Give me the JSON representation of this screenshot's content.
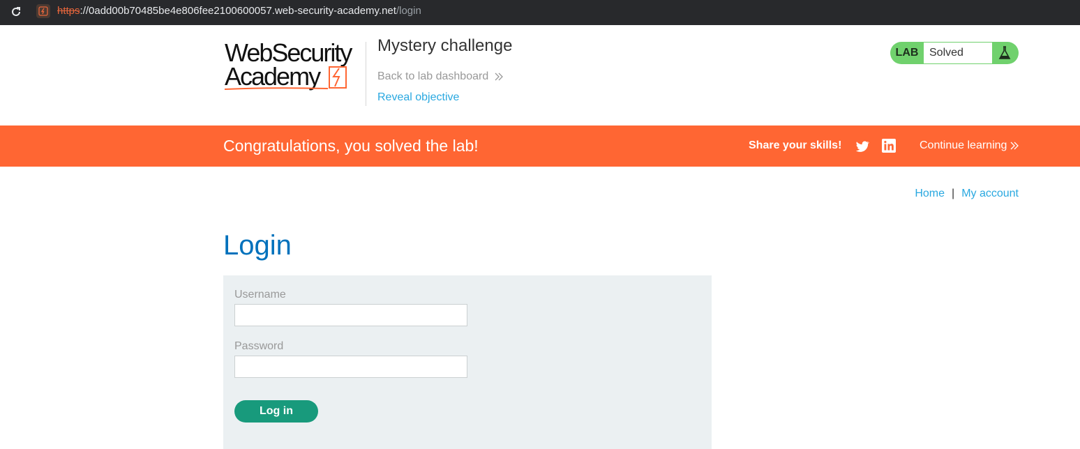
{
  "browser": {
    "url_scheme": "https",
    "url_host": "://0add00b70485be4e806fee2100600057.web-security-academy.net",
    "url_path": "/login",
    "icons": {
      "reload": "reload-icon",
      "site": "site-lightning-icon"
    }
  },
  "header": {
    "logo_text_line1": "WebSecurity",
    "logo_text_line2": "Academy",
    "lab_title": "Mystery challenge",
    "back_link": "Back to lab dashboard",
    "reveal_link": "Reveal objective",
    "lab_badge": {
      "label": "LAB",
      "status": "Solved",
      "icon": "flask-icon"
    }
  },
  "banner": {
    "message": "Congratulations, you solved the lab!",
    "share_label": "Share your skills!",
    "continue_label": "Continue learning",
    "icons": {
      "twitter": "twitter-icon",
      "linkedin": "linkedin-icon",
      "continue": "double-chevron-right-icon"
    }
  },
  "nav": {
    "home": "Home",
    "separator": "|",
    "my_account": "My account"
  },
  "login": {
    "title": "Login",
    "username_label": "Username",
    "username_value": "",
    "password_label": "Password",
    "password_value": "",
    "submit_label": "Log in"
  },
  "colors": {
    "brand_orange": "#ff6633",
    "link_blue": "#29a8e0",
    "title_blue": "#0071bc",
    "solved_green": "#70d16d",
    "button_green": "#189a7c",
    "panel_gray": "#ebf0f2"
  }
}
